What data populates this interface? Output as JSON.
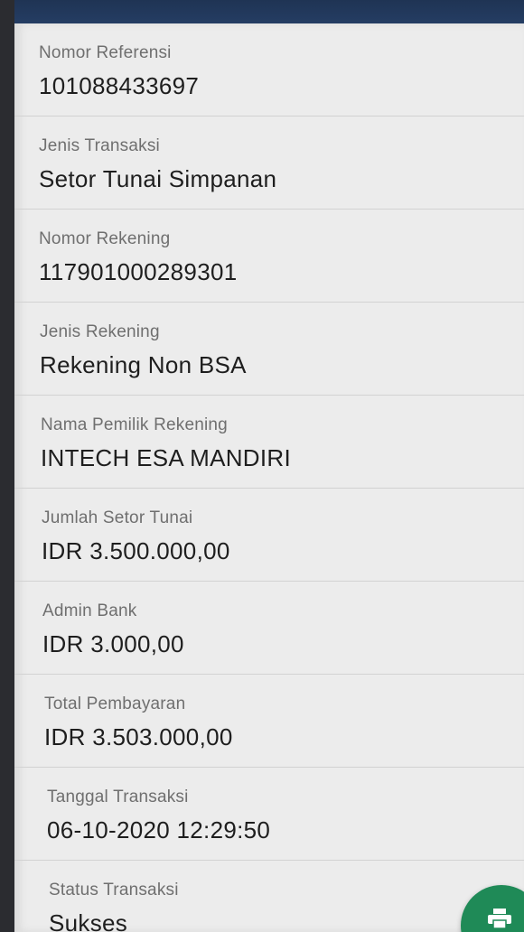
{
  "details": [
    {
      "label": "Nomor Referensi",
      "value": "101088433697"
    },
    {
      "label": "Jenis Transaksi",
      "value": "Setor Tunai Simpanan"
    },
    {
      "label": "Nomor Rekening",
      "value": "117901000289301"
    },
    {
      "label": "Jenis Rekening",
      "value": "Rekening Non BSA"
    },
    {
      "label": "Nama Pemilik Rekening",
      "value": "INTECH ESA MANDIRI"
    },
    {
      "label": "Jumlah Setor Tunai",
      "value": "IDR 3.500.000,00"
    },
    {
      "label": "Admin Bank",
      "value": "IDR 3.000,00"
    },
    {
      "label": "Total Pembayaran",
      "value": "IDR 3.503.000,00"
    },
    {
      "label": "Tanggal Transaksi",
      "value": "06-10-2020 12:29:50"
    },
    {
      "label": "Status Transaksi",
      "value": "Sukses"
    }
  ],
  "print_button": {
    "icon": "print-icon",
    "color": "#1f8a57"
  },
  "colors": {
    "header": "#27416a",
    "card": "#ececec",
    "label": "#6f6f6f",
    "value": "#1e1e1e"
  }
}
